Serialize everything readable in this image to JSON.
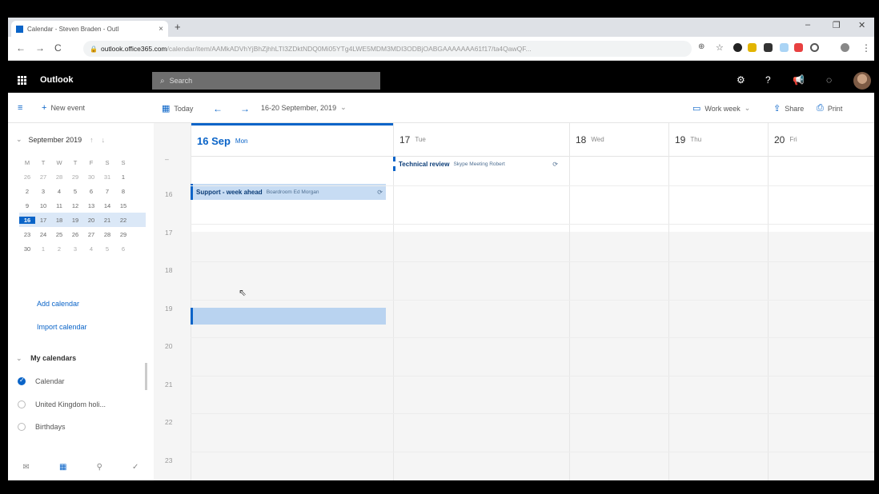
{
  "browser": {
    "tab_title": "Calendar - Steven Braden - Outl",
    "tab_close": "×",
    "new_tab": "+",
    "url_domain": "outlook.office365.com",
    "url_path": "/calendar/item/AAMkADVhYjBhZjhhLTI3ZDktNDQ0Mi05YTg4LWE5MDM3MDI3ODBjOABGAAAAAAA61f17/ta4QawQF...",
    "minimize": "–",
    "restore": "❐",
    "close": "✕",
    "back": "←",
    "forward": "→",
    "reload": "C"
  },
  "outlook": {
    "brand": "Outlook",
    "search_placeholder": "Search"
  },
  "commands": {
    "new_event": "New event",
    "today": "Today",
    "date_range": "16-20 September, 2019",
    "view": "Work week",
    "share": "Share",
    "print": "Print"
  },
  "minical": {
    "title": "September 2019",
    "dow": [
      "M",
      "T",
      "W",
      "T",
      "F",
      "S",
      "S"
    ],
    "weeks": [
      [
        "26",
        "27",
        "28",
        "29",
        "30",
        "31",
        "1"
      ],
      [
        "2",
        "3",
        "4",
        "5",
        "6",
        "7",
        "8"
      ],
      [
        "9",
        "10",
        "11",
        "12",
        "13",
        "14",
        "15"
      ],
      [
        "16",
        "17",
        "18",
        "19",
        "20",
        "21",
        "22"
      ],
      [
        "23",
        "24",
        "25",
        "26",
        "27",
        "28",
        "29"
      ],
      [
        "30",
        "1",
        "2",
        "3",
        "4",
        "5",
        "6"
      ]
    ]
  },
  "left_links": {
    "add_calendar": "Add calendar",
    "import_calendar": "Import calendar"
  },
  "my_calendars": {
    "heading": "My calendars",
    "items": [
      "Calendar",
      "United Kingdom holi...",
      "Birthdays"
    ]
  },
  "days": [
    {
      "num": "16 Sep",
      "dow": "Mon"
    },
    {
      "num": "17",
      "dow": "Tue"
    },
    {
      "num": "18",
      "dow": "Wed"
    },
    {
      "num": "19",
      "dow": "Thu"
    },
    {
      "num": "20",
      "dow": "Fri"
    }
  ],
  "hours": [
    "16",
    "17",
    "18",
    "19",
    "20",
    "21",
    "22",
    "23"
  ],
  "events": {
    "support": {
      "title": "Support - week ahead",
      "detail": "Boardroom Ed Morgan"
    },
    "technical": {
      "title": "Technical review",
      "detail": "Skype Meeting Robert"
    }
  },
  "colors": {
    "accent": "#0a64c8",
    "event_fill": "#c7dcf3"
  }
}
